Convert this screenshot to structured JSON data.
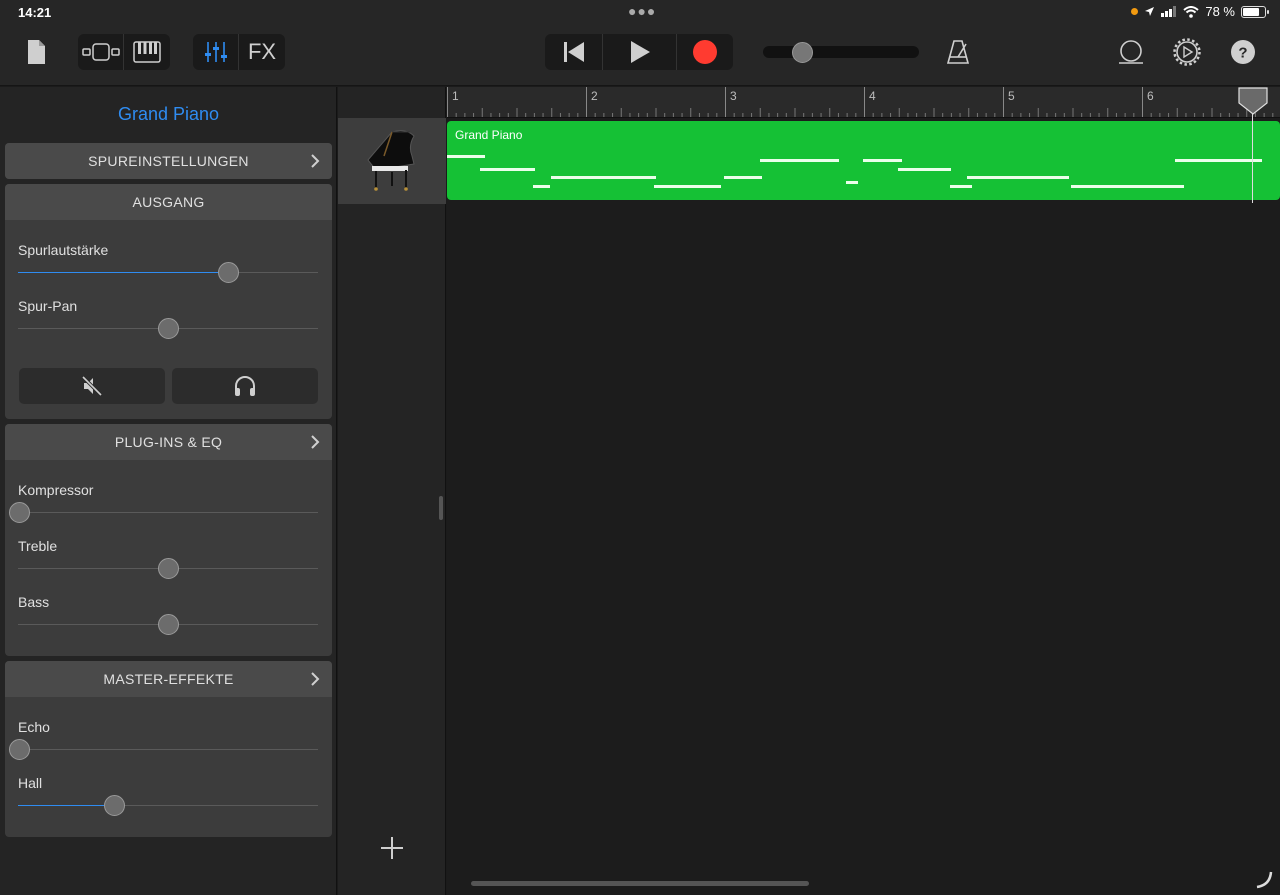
{
  "status_bar": {
    "time": "14:21",
    "battery": "78 %",
    "battery_level": 0.78,
    "icons": [
      "orange-dot-icon",
      "location-arrow-icon",
      "cellular-signal-icon",
      "wifi-icon",
      "battery-icon"
    ]
  },
  "toolbar": {
    "left_icons": [
      "document-icon",
      "tracks-view-icon",
      "keyboard-icon",
      "mixer-icon"
    ],
    "fx_label": "FX",
    "transport_icons": [
      "go-to-start-icon",
      "play-icon",
      "record-icon"
    ],
    "record_color": "#ff3b30",
    "right_icons": [
      "metronome-icon",
      "loop-icon",
      "settings-gear-icon",
      "help-icon"
    ],
    "help_label": "?"
  },
  "left_panel": {
    "track_name": "Grand Piano",
    "accent_color": "#2f8cf1",
    "track_settings": {
      "label": "SPUREINSTELLUNGEN"
    },
    "output": {
      "label": "AUSGANG",
      "params": [
        {
          "label": "Spurlautstärke",
          "value": 0.7,
          "fill": true
        },
        {
          "label": "Spur-Pan",
          "value": 0.5,
          "fill": false
        }
      ],
      "mute_icon": "mute-speaker-icon",
      "solo_icon": "headphones-icon"
    },
    "plugins_eq": {
      "label": "PLUG-INS & EQ",
      "params": [
        {
          "label": "Kompressor",
          "value": 0.0,
          "fill": false
        },
        {
          "label": "Treble",
          "value": 0.5,
          "fill": false
        },
        {
          "label": "Bass",
          "value": 0.5,
          "fill": false
        }
      ]
    },
    "master_effects": {
      "label": "MASTER-EFFEKTE",
      "params": [
        {
          "label": "Echo",
          "value": 0.0,
          "fill": false
        },
        {
          "label": "Hall",
          "value": 0.32,
          "fill": true
        }
      ]
    }
  },
  "timeline": {
    "bars": [
      "1",
      "2",
      "3",
      "4",
      "5",
      "6"
    ],
    "region": {
      "name": "Grand Piano",
      "color": "#15c135"
    },
    "add_track_icon": "plus-icon"
  }
}
